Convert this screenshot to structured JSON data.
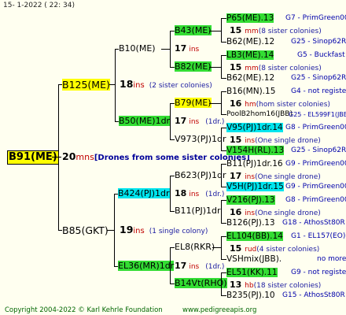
{
  "header": "15-  1-2022 ( 22: 34)",
  "footer": {
    "copyright": "Copyright 2004-2022 © Karl Kehrle Foundation",
    "url": "www.pedigreeapis.org"
  },
  "root": {
    "name": "B91(ME)",
    "count": "20",
    "unit": "mns",
    "note": "[Drones from some sister colonies]"
  },
  "gen1": [
    {
      "name": "B125(ME)",
      "count": "18",
      "unit": "ins",
      "note": "(2 sister colonies)"
    },
    {
      "name": "B85(GKT)",
      "count": "19",
      "unit": "ins",
      "note": "(1 single colony)"
    }
  ],
  "gen2": [
    {
      "name": "B10(ME)",
      "count": "17",
      "unit": "ins",
      "note": ""
    },
    {
      "name": "B50(ME)1dr",
      "count": "17",
      "unit": "ins",
      "note": "(1dr.)"
    },
    {
      "name": "B424(PJ)1dr",
      "count": "18",
      "unit": "ins",
      "note": "(1dr.)"
    },
    {
      "name": "EL36(MR)1dr",
      "count": "17",
      "unit": "ins",
      "note": "(1dr.)"
    }
  ],
  "gen3": [
    {
      "name": "B43(ME)"
    },
    {
      "name": "B82(ME)"
    },
    {
      "name": "B79(ME)"
    },
    {
      "name": "V973(PJ)1dr"
    },
    {
      "name": "B623(PJ)1dr"
    },
    {
      "name": "B11(PJ)1dr"
    },
    {
      "name": "EL8(RKR)"
    },
    {
      "name": "B14Vt(RHO)"
    }
  ],
  "gen4": [
    {
      "name": "P65(ME).13",
      "right": "G7 - PrimGreen00"
    },
    {
      "count": "15",
      "unit": "mm",
      "note": "(8 sister colonies)"
    },
    {
      "name": "B62(ME).12",
      "right": "G25 - Sinop62R"
    },
    {
      "name": "LB3(ME).14",
      "right": "G5 - Buckfast"
    },
    {
      "count": "15",
      "unit": "mm",
      "note": "(8 sister colonies)"
    },
    {
      "name": "B62(ME).12",
      "right": "G25 - Sinop62R"
    },
    {
      "name": "B16(MN).15",
      "right": "G4 - not registe"
    },
    {
      "count": "16",
      "unit": "hm",
      "note": "(hom sister colonies)"
    },
    {
      "name": "PoolB2hom16(JBB)",
      "right": "G25 - EL599F1(JBB"
    },
    {
      "name": "V95(PJ)1dr.14",
      "right": "G8 - PrimGreen00"
    },
    {
      "count": "15",
      "unit": "ins",
      "note": "(One single drone)"
    },
    {
      "name": "V154H(RL).13",
      "right": "G25 - Sinop62R"
    },
    {
      "name": "B11(PJ)1dr.16",
      "right": "G9 - PrimGreen00"
    },
    {
      "count": "17",
      "unit": "ins",
      "note": "(One single drone)"
    },
    {
      "name": "V5H(PJ)1dr.15",
      "right": "G9 - PrimGreen00"
    },
    {
      "name": "V216(PJ).13",
      "right": "G8 - PrimGreen00"
    },
    {
      "count": "16",
      "unit": "ins",
      "note": "(One single drone)"
    },
    {
      "name": "B126(PJ).13",
      "right": "G18 - AthosSt80R"
    },
    {
      "name": "EL104(BB).14",
      "right": "G1 - EL157(EO)"
    },
    {
      "count": "15",
      "unit": "rud",
      "note": "(4 sister colonies)"
    },
    {
      "name": "VSHmix(JBB).",
      "right": "no more"
    },
    {
      "name": "EL51(KK).11",
      "right": "G9 - not registe"
    },
    {
      "count": "13",
      "unit": "hb",
      "note": "(18 sister colonies)"
    },
    {
      "name": "B235(PJ).10",
      "right": "G15 - AthosSt80R"
    }
  ],
  "colors": {
    "yellow": "#ffff00",
    "green": "#33dd33",
    "cyan": "#00e5ee",
    "unit_red": "#c00000",
    "note_blue": "#1a1aa0"
  }
}
